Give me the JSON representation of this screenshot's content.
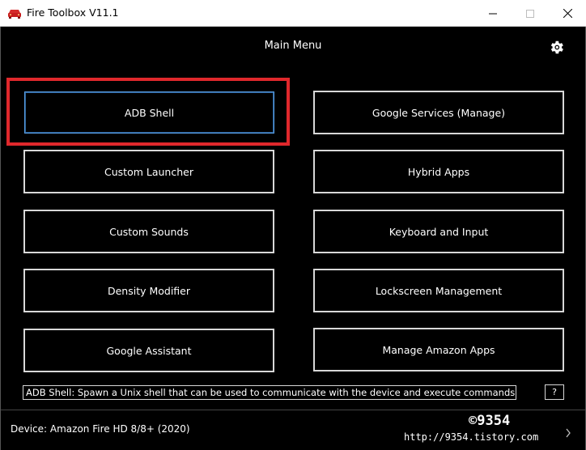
{
  "window": {
    "title": "Fire Toolbox V11.1"
  },
  "header": {
    "title": "Main Menu"
  },
  "menu": {
    "left": [
      {
        "label": "ADB Shell",
        "selected": true
      },
      {
        "label": "Custom Launcher"
      },
      {
        "label": "Custom Sounds"
      },
      {
        "label": "Density Modifier"
      },
      {
        "label": "Google Assistant"
      }
    ],
    "right": [
      {
        "label": "Google Services (Manage)"
      },
      {
        "label": "Hybrid Apps"
      },
      {
        "label": "Keyboard and Input"
      },
      {
        "label": "Lockscreen Management"
      },
      {
        "label": "Manage Amazon Apps"
      }
    ]
  },
  "description": "ADB Shell: Spawn a Unix shell that can be used to communicate with the device and execute commands.",
  "help_label": "?",
  "footer": {
    "device": "Device: Amazon Fire HD 8/8+ (2020)"
  },
  "watermark": {
    "top": "©9354",
    "bottom": "http://9354.tistory.com"
  },
  "colors": {
    "background": "#000000",
    "button_border": "#d8d8d8",
    "selected_border": "#5aa0e6",
    "annotation_red": "#e0282c"
  },
  "icons": [
    "app-icon",
    "minimize-icon",
    "maximize-icon",
    "close-icon",
    "gear-icon",
    "chevron-right-icon"
  ]
}
